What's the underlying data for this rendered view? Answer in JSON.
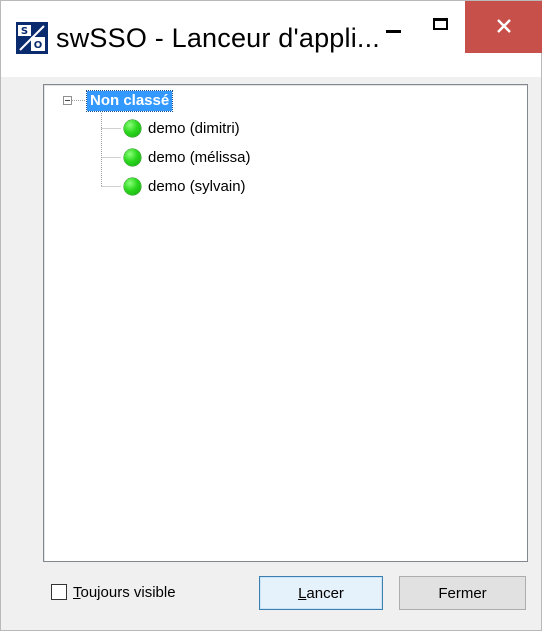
{
  "window": {
    "title": "swSSO - Lanceur d'appli...",
    "close_color": "#c7504a"
  },
  "titlebar_buttons": {
    "minimize_icon": "minimize-icon",
    "maximize_icon": "maximize-icon",
    "close_icon": "close-icon"
  },
  "tree": {
    "root": {
      "label": "Non classé",
      "expanded": true,
      "selected": true
    },
    "children": [
      {
        "label": "demo (dimitri)",
        "icon": "green-circle-icon",
        "status_color": "#2bd81e"
      },
      {
        "label": "demo (mélissa)",
        "icon": "green-circle-icon",
        "status_color": "#2bd81e"
      },
      {
        "label": "demo (sylvain)",
        "icon": "green-circle-icon",
        "status_color": "#2bd81e"
      }
    ]
  },
  "footer": {
    "always_visible": {
      "mnemonic": "T",
      "rest": "oujours visible",
      "checked": false
    },
    "launch_button": {
      "mnemonic": "L",
      "rest": "ancer"
    },
    "close_button": {
      "label": "Fermer"
    }
  },
  "colors": {
    "selection": "#3399ff",
    "launch_button_border": "#3c7fb1"
  }
}
